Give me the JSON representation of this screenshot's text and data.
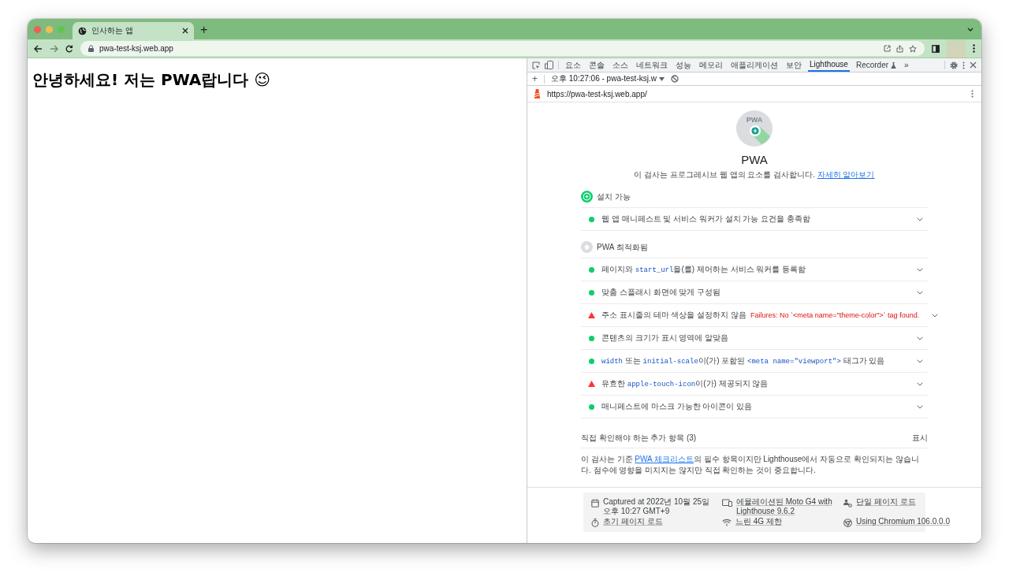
{
  "browser": {
    "tabs": [
      {
        "title": "인사하는 앱",
        "selected": true
      }
    ],
    "new_tab": "+",
    "address": "pwa-test-ksj.web.app"
  },
  "page": {
    "heading": "안녕하세요! 저는 PWA랍니다 😉"
  },
  "devtools": {
    "tabs": [
      {
        "label": "요소",
        "selected": false
      },
      {
        "label": "콘솔",
        "selected": false
      },
      {
        "label": "소스",
        "selected": false
      },
      {
        "label": "네트워크",
        "selected": false
      },
      {
        "label": "성능",
        "selected": false
      },
      {
        "label": "메모리",
        "selected": false
      },
      {
        "label": "애플리케이션",
        "selected": false
      },
      {
        "label": "보안",
        "selected": false
      },
      {
        "label": "Lighthouse",
        "selected": true
      },
      {
        "label": "Recorder",
        "selected": false,
        "kind": "experimental"
      }
    ],
    "overflow": "»",
    "add": "+",
    "report_selector": "오후 10:27:06 - pwa-test-ksj.w",
    "report_url": "https://pwa-test-ksj.web.app/"
  },
  "report": {
    "gauge_label": "PWA",
    "title": "PWA",
    "description": "이 검사는 프로그레시브 웹 앱의 요소를 검사합니다.",
    "learn_more": "자세히 알아보기",
    "groups": [
      {
        "title": "설치 가능",
        "kind": "installable",
        "audits": [
          {
            "passed": true,
            "parts": [
              {
                "text": "웹 앱 매니페스트 및 서비스 워커가 설치 가능 요건을 충족함"
              }
            ]
          }
        ]
      },
      {
        "title": "PWA 최적화됨",
        "kind": "optimized",
        "audits": [
          {
            "passed": true,
            "parts": [
              {
                "text": "페이지와 "
              },
              {
                "text": "start_url",
                "kind": "code"
              },
              {
                "text": "을(를) 제어하는 서비스 워커를 등록함"
              }
            ]
          },
          {
            "passed": true,
            "parts": [
              {
                "text": "맞춤 스플래시 화면에 맞게 구성됨"
              }
            ]
          },
          {
            "passed": false,
            "parts": [
              {
                "text": "주소 표시줄의 테마 색상을 설정하지 않음"
              }
            ],
            "failure": "Failures: No `<meta name=\"theme-color\">` tag found."
          },
          {
            "passed": true,
            "parts": [
              {
                "text": "콘텐츠의 크기가 표시 영역에 알맞음"
              }
            ]
          },
          {
            "passed": true,
            "parts": [
              {
                "text": "width",
                "kind": "code"
              },
              {
                "text": " 또는 "
              },
              {
                "text": "initial-scale",
                "kind": "code"
              },
              {
                "text": "이(가) 포함된 "
              },
              {
                "text": "<meta name=\"viewport\">",
                "kind": "code"
              },
              {
                "text": " 태그가 있음"
              }
            ]
          },
          {
            "passed": false,
            "parts": [
              {
                "text": "유효한 "
              },
              {
                "text": "apple-touch-icon",
                "kind": "code"
              },
              {
                "text": "이(가) 제공되지 않음"
              }
            ]
          },
          {
            "passed": true,
            "parts": [
              {
                "text": "매니페스트에 마스크 가능한 아이콘이 있음"
              }
            ]
          }
        ]
      }
    ],
    "manual": {
      "title": "직접 확인해야 하는 추가 항목 (3)",
      "toggle": "표시",
      "parts": [
        {
          "text": "이 검사는 기준 "
        },
        {
          "text": "PWA 체크리스트",
          "kind": "link"
        },
        {
          "text": "의 필수 항목이지만 Lighthouse에서 자동으로 확인되지는 않습니다. 점수에 영향을 미치지는 않지만 직접 확인하는 것이 중요합니다."
        }
      ]
    },
    "environment": [
      {
        "kind": "captured",
        "link": false,
        "lines": [
          "Captured at 2022년 10월 25일",
          "오후 10:27 GMT+9"
        ]
      },
      {
        "kind": "device",
        "link": true,
        "lines": [
          "에뮬레이션된 Moto G4 with",
          "Lighthouse 9.6.2"
        ]
      },
      {
        "kind": "page",
        "link": true,
        "lines": [
          "단일 페이지 로드"
        ]
      },
      {
        "kind": "timer",
        "link": true,
        "lines": [
          "초기 페이지 로드"
        ]
      },
      {
        "kind": "network",
        "link": true,
        "lines": [
          "느린 4G 제한"
        ]
      },
      {
        "kind": "browser",
        "link": true,
        "lines": [
          "Using Chromium 106.0.0.0"
        ]
      }
    ]
  }
}
